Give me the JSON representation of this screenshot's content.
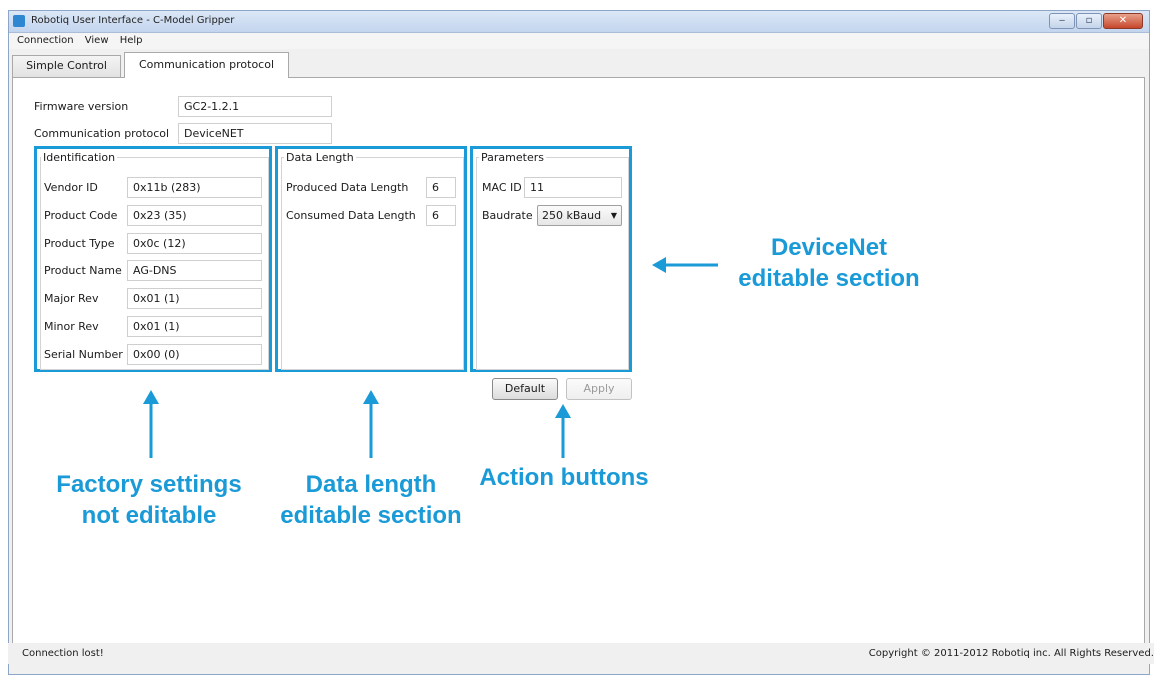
{
  "window": {
    "title": "Robotiq User Interface - C-Model Gripper",
    "controls": {
      "minimize": "‒",
      "maximize": "▫",
      "close": "✕"
    }
  },
  "menu": [
    "Connection",
    "View",
    "Help"
  ],
  "tabs": [
    {
      "label": "Simple Control",
      "active": false
    },
    {
      "label": "Communication protocol",
      "active": true
    }
  ],
  "info": {
    "firmware_label": "Firmware version",
    "firmware_value": "GC2-1.2.1",
    "protocol_label": "Communication protocol",
    "protocol_value": "DeviceNET"
  },
  "identification": {
    "title": "Identification",
    "fields": [
      {
        "label": "Vendor ID",
        "value": "0x11b (283)"
      },
      {
        "label": "Product Code",
        "value": "0x23 (35)"
      },
      {
        "label": "Product Type",
        "value": "0x0c (12)"
      },
      {
        "label": "Product Name",
        "value": "AG-DNS"
      },
      {
        "label": "Major Rev",
        "value": "0x01 (1)"
      },
      {
        "label": "Minor Rev",
        "value": "0x01 (1)"
      },
      {
        "label": "Serial Number",
        "value": "0x00 (0)"
      }
    ]
  },
  "data_length": {
    "title": "Data Length",
    "fields": [
      {
        "label": "Produced Data Length",
        "value": "6"
      },
      {
        "label": "Consumed Data Length",
        "value": "6"
      }
    ]
  },
  "parameters": {
    "title": "Parameters",
    "mac_label": "MAC ID",
    "mac_value": "11",
    "baudrate_label": "Baudrate",
    "baudrate_value": "250 kBaud"
  },
  "buttons": {
    "default": "Default",
    "apply": "Apply"
  },
  "status": {
    "left": "Connection lost!",
    "right": "Copyright © 2011-2012 Robotiq inc. All Rights Reserved."
  },
  "annotations": {
    "devicenet": [
      "DeviceNet",
      "editable section"
    ],
    "factory": [
      "Factory settings",
      "not editable"
    ],
    "datalength": [
      "Data length",
      "editable section"
    ],
    "action": [
      "Action buttons"
    ]
  },
  "colors": {
    "annotation": "#1a9ad6",
    "window_border": "#8da6c8"
  }
}
